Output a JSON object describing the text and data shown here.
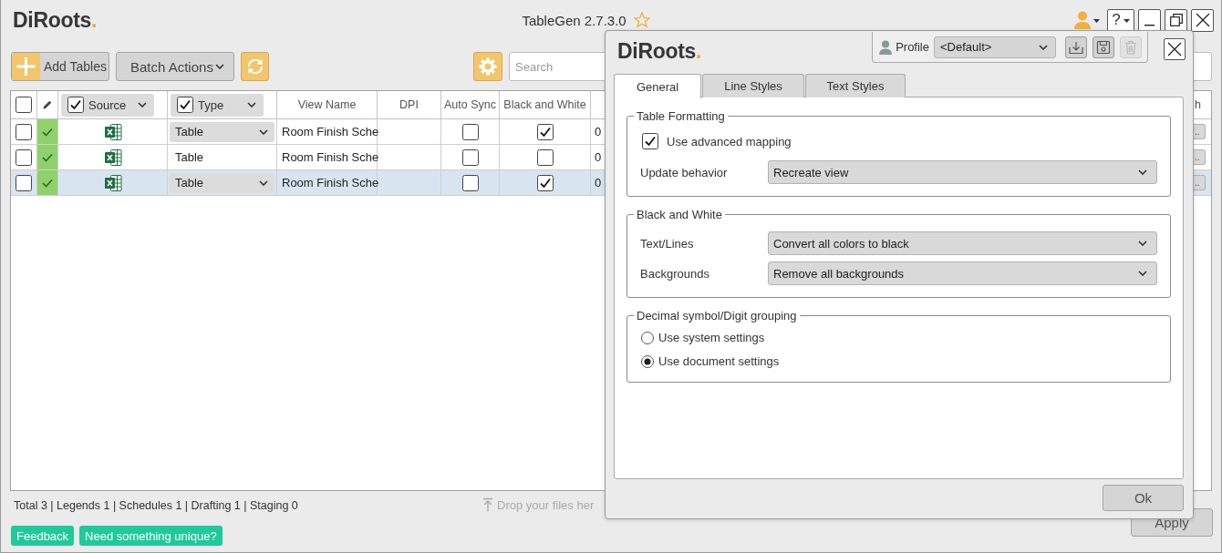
{
  "window": {
    "logo": {
      "name": "DiRoots",
      "mark": "."
    },
    "title": "TableGen 2.7.3.0",
    "help": {
      "label": "?"
    }
  },
  "toolbar": {
    "add_button": {
      "label": "Add Tables"
    },
    "batch_actions": {
      "label": "Batch Actions"
    },
    "search": {
      "placeholder": "Search"
    }
  },
  "table": {
    "select_all_checked": false,
    "columns": [
      {
        "kind": "select"
      },
      {
        "kind": "edit"
      },
      {
        "kind": "filter",
        "label": "Source",
        "checked": true
      },
      {
        "kind": "filter",
        "label": "Type",
        "checked": true
      },
      {
        "kind": "text",
        "label": "View Name"
      },
      {
        "kind": "text",
        "label": "DPI"
      },
      {
        "kind": "text",
        "label": "Auto Sync"
      },
      {
        "kind": "text",
        "label": "Black and White"
      },
      {
        "kind": "text"
      },
      {
        "kind": "text",
        "label": "h"
      }
    ],
    "rows": [
      {
        "selected": false,
        "checked": false,
        "synced": true,
        "type": {
          "kind": "dropdown",
          "value": "Table"
        },
        "view_name": "Room Finish Sche",
        "auto_sync": false,
        "black_and_white": true,
        "column_9": "0",
        "column_10": {
          "label": ".."
        }
      },
      {
        "selected": false,
        "checked": false,
        "synced": true,
        "type": {
          "kind": "text",
          "value": "Table"
        },
        "view_name": "Room Finish Sche",
        "auto_sync": false,
        "black_and_white": false,
        "column_9": "0",
        "column_10": {
          "label": ".."
        }
      },
      {
        "selected": true,
        "checked": false,
        "synced": true,
        "type": {
          "kind": "dropdown",
          "value": "Table"
        },
        "view_name": "Room Finish Sche",
        "auto_sync": false,
        "black_and_white": true,
        "column_9": "0",
        "column_10": {
          "label": ".."
        }
      }
    ]
  },
  "status_bar": {
    "summary": "Total 3 | Legends 1 | Schedules 1 | Drafting 1 | Staging 0",
    "drop_hint": "Drop your files her"
  },
  "footer": {
    "links": [
      {
        "label": "Feedback"
      },
      {
        "label": "Need something unique?"
      }
    ],
    "apply": {
      "label": "Apply"
    }
  },
  "dialog": {
    "logo": {
      "name": "DiRoots",
      "mark": "."
    },
    "profile": {
      "label": "Profile",
      "value": "<Default>",
      "actions": [
        {
          "kind": "import",
          "disabled": false
        },
        {
          "kind": "save",
          "disabled": false
        },
        {
          "kind": "delete",
          "disabled": true
        }
      ]
    },
    "tabs": [
      {
        "label": "General",
        "selected": true
      },
      {
        "label": "Line Styles",
        "selected": false
      },
      {
        "label": "Text Styles",
        "selected": false
      }
    ],
    "groups": [
      {
        "title": "Table Formatting",
        "items": [
          {
            "kind": "checkbox",
            "label": "Use advanced mapping",
            "checked": true
          },
          {
            "kind": "select",
            "label": "Update behavior",
            "value": "Recreate view"
          }
        ]
      },
      {
        "title": "Black and White",
        "items": [
          {
            "kind": "select",
            "label": "Text/Lines",
            "value": "Convert all colors to black"
          },
          {
            "kind": "select",
            "label": "Backgrounds",
            "value": "Remove all backgrounds"
          }
        ]
      },
      {
        "title": "Decimal symbol/Digit grouping",
        "items": [
          {
            "kind": "radio",
            "label": "Use system settings",
            "selected": false
          },
          {
            "kind": "radio",
            "label": "Use document settings",
            "selected": true
          }
        ]
      }
    ],
    "ok": {
      "label": "Ok"
    }
  }
}
